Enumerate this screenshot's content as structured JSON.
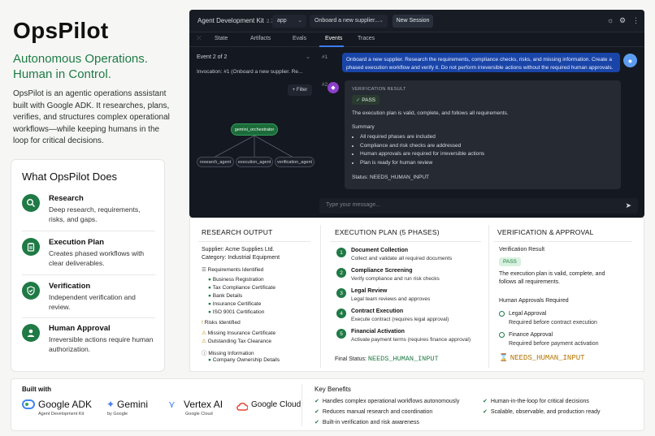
{
  "brand": {
    "name": "OpsPilot",
    "tagline": "Autonomous Operations. Human in Control.",
    "intro": "OpsPilot is an agentic operations assistant built with Google ADK. It researches, plans, verifies, and structures complex operational workflows—while keeping humans in the loop for critical decisions."
  },
  "features": {
    "title": "What OpsPilot Does",
    "items": [
      {
        "title": "Research",
        "desc": "Deep research, requirements, risks, and gaps.",
        "icon": "search-icon"
      },
      {
        "title": "Execution Plan",
        "desc": "Creates phased workflows with clear deliverables.",
        "icon": "clipboard-icon"
      },
      {
        "title": "Verification",
        "desc": "Independent verification and review.",
        "icon": "shield-check-icon"
      },
      {
        "title": "Human Approval",
        "desc": "Irreversible actions require human authorization.",
        "icon": "person-icon"
      }
    ]
  },
  "app": {
    "title": "Agent Development Kit",
    "version": "2.7.1",
    "app_select": "app",
    "session_select": "Onboard a new supplier...",
    "new_session": "New Session",
    "tabs": [
      "State",
      "Artifacts",
      "Evals",
      "Events",
      "Traces"
    ],
    "active_tab": "Events",
    "event_header": "Event 2 of 2",
    "invocation": "Invocation:  #1 (Onboard a new supplier. Re...",
    "filter": "+ Filter",
    "graph": {
      "root": "gemini_orchestrator",
      "children": [
        "research_agent",
        "execution_agent",
        "verification_agent"
      ]
    },
    "msg1_num": "#1",
    "msg1": "Onboard a new supplier. Research the requirements, compliance checks, risks, and missing information. Create a phased execution workflow and verify it. Do not perform irreversible actions without the required human approvals.",
    "msg2_num": "#2",
    "verification": {
      "label": "VERIFICATION RESULT",
      "badge": "PASS",
      "statement": "The execution plan is valid, complete, and follows all requirements.",
      "summary_label": "Summary",
      "bullets": [
        "All required phases are included",
        "Compliance and risk checks are addressed",
        "Human approvals are required for irreversible actions",
        "Plan is ready for human review"
      ],
      "status": "Status: NEEDS_HUMAN_INPUT"
    },
    "input_placeholder": "Type your message..."
  },
  "research": {
    "title": "RESEARCH OUTPUT",
    "supplier": "Supplier: Acme Supplies Ltd.",
    "category": "Category: Industrial Equipment",
    "req_label": "Requirements Identified",
    "requirements": [
      "Business Registration",
      "Tax Compliance Certificate",
      "Bank Details",
      "Insurance Certificate",
      "ISO 9001 Certification"
    ],
    "risk_label": "Risks Identified",
    "risks": [
      "Missing Insurance Certificate",
      "Outstanding Tax Clearance"
    ],
    "missing_label": "Missing Information",
    "missing": [
      "Company Ownership Details"
    ]
  },
  "plan": {
    "title": "EXECUTION PLAN (5 PHASES)",
    "steps": [
      {
        "n": "1",
        "title": "Document Collection",
        "desc": "Collect and validate all required documents"
      },
      {
        "n": "2",
        "title": "Compliance Screening",
        "desc": "Verify compliance and run risk checks"
      },
      {
        "n": "3",
        "title": "Legal Review",
        "desc": "Legal team reviews and approves"
      },
      {
        "n": "4",
        "title": "Contract Execution",
        "desc": "Execute contract (requires legal approval)"
      },
      {
        "n": "5",
        "title": "Financial Activation",
        "desc": "Activate payment terms (requires finance approval)"
      }
    ],
    "final_label": "Final Status:",
    "final_value": "NEEDS_HUMAN_INPUT"
  },
  "verify": {
    "title": "VERIFICATION & APPROVAL",
    "result_label": "Verification Result",
    "badge": "PASS",
    "statement": "The execution plan is valid, complete, and follows all requirements.",
    "approvals_label": "Human Approvals Required",
    "approvals": [
      {
        "title": "Legal Approval",
        "desc": "Required before contract execution"
      },
      {
        "title": "Finance Approval",
        "desc": "Required before payment activation"
      }
    ],
    "status": "NEEDS_HUMAN_INPUT"
  },
  "built_with": {
    "label": "Built with",
    "logos": [
      {
        "name": "Google ADK",
        "sub": "Agent Development Kit"
      },
      {
        "name": "Gemini",
        "sub": "by Google"
      },
      {
        "name": "Vertex AI",
        "sub": "Google Cloud"
      },
      {
        "name": "Google Cloud",
        "sub": ""
      }
    ]
  },
  "benefits": {
    "label": "Key Benefits",
    "items": [
      "Handles complex operational workflows autonomously",
      "Reduces manual research and coordination",
      "Built-in verification and risk awareness",
      "Human-in-the-loop for critical decisions",
      "Scalable, observable, and production ready"
    ]
  },
  "colors": {
    "accent": "#1f7a45",
    "user_bubble": "#1a45a8",
    "app_bg": "#141820",
    "amber": "#b37400"
  }
}
